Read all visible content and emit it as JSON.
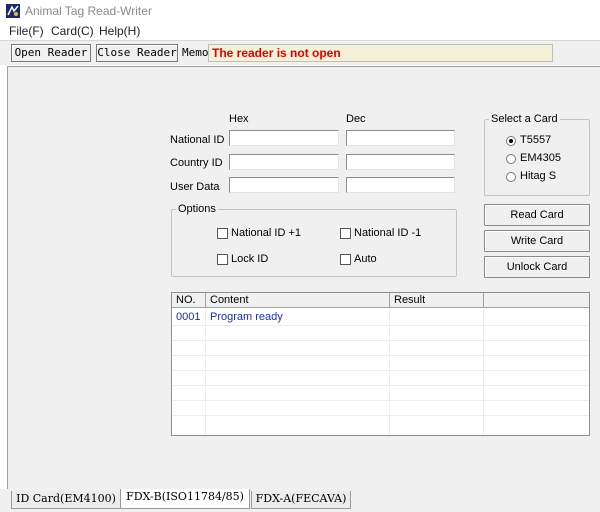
{
  "window": {
    "title": "Animal Tag Read-Writer"
  },
  "menu": [
    "File(F)",
    "Card(C)",
    "Help(H)"
  ],
  "toolbar": {
    "open_reader": "Open Reader",
    "close_reader": "Close Reader",
    "memo_label": "Memo",
    "memo_value": "The reader is not open"
  },
  "form": {
    "col_hex": "Hex",
    "col_dec": "Dec",
    "national_id": {
      "label": "National ID",
      "hex": "",
      "dec": ""
    },
    "country_id": {
      "label": "Country ID",
      "hex": "",
      "dec": ""
    },
    "user_data": {
      "label": "User Data",
      "hex": "",
      "dec": ""
    }
  },
  "select_card": {
    "title": "Select a Card",
    "options": [
      {
        "label": "T5557",
        "selected": true
      },
      {
        "label": "EM4305",
        "selected": false
      },
      {
        "label": "Hitag S",
        "selected": false
      }
    ]
  },
  "options": {
    "title": "Options",
    "national_id_plus": {
      "label": "National ID +1",
      "checked": false
    },
    "national_id_minus": {
      "label": "National ID -1",
      "checked": false
    },
    "lock_id": {
      "label": "Lock ID",
      "checked": false
    },
    "auto": {
      "label": "Auto",
      "checked": false
    }
  },
  "actions": {
    "read_card": "Read Card",
    "write_card": "Write Card",
    "unlock_card": "Unlock Card"
  },
  "log_table": {
    "columns": [
      "NO.",
      "Content",
      "Result",
      ""
    ],
    "rows": [
      {
        "no": "0001",
        "content": "Program ready",
        "result": ""
      }
    ]
  },
  "tabs": [
    {
      "label": "ID Card(EM4100)",
      "active": false
    },
    {
      "label": "FDX-B(ISO11784/85)",
      "active": true
    },
    {
      "label": "FDX-A(FECAVA)",
      "active": false
    }
  ],
  "colors": {
    "memo_text": "#e00000",
    "log_text": "#1b2fb0"
  }
}
